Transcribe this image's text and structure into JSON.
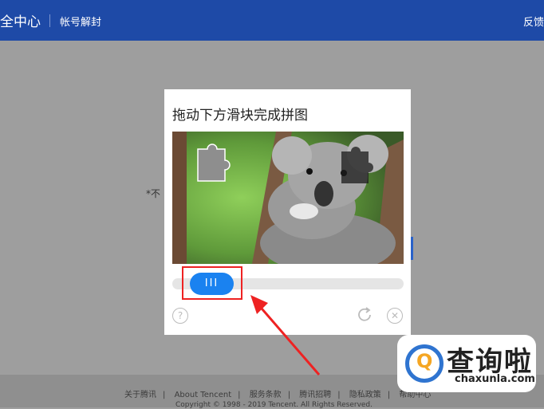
{
  "header": {
    "title": "全中心",
    "subtitle": "帐号解封",
    "right_link": "反馈"
  },
  "background": {
    "partial_text": "*不"
  },
  "footer": {
    "links": [
      "关于腾讯",
      "About Tencent",
      "服务条款",
      "腾讯招聘",
      "隐私政策",
      "帮助中心"
    ],
    "copyright": "Copyright © 1998 - 2019 Tencent. All Rights Reserved."
  },
  "captcha": {
    "title": "拖动下方滑块完成拼图",
    "slider_grip": "III",
    "help_icon": "question-icon",
    "refresh_icon": "refresh-icon",
    "close_icon": "close-icon"
  },
  "watermark": {
    "brand": "查询啦",
    "domain": "chaxunla.com"
  },
  "colors": {
    "header_blue": "#1e4aa7",
    "slider_blue": "#1a82f0",
    "annotation_red": "#e22222",
    "logo_orange": "#f5a623"
  }
}
